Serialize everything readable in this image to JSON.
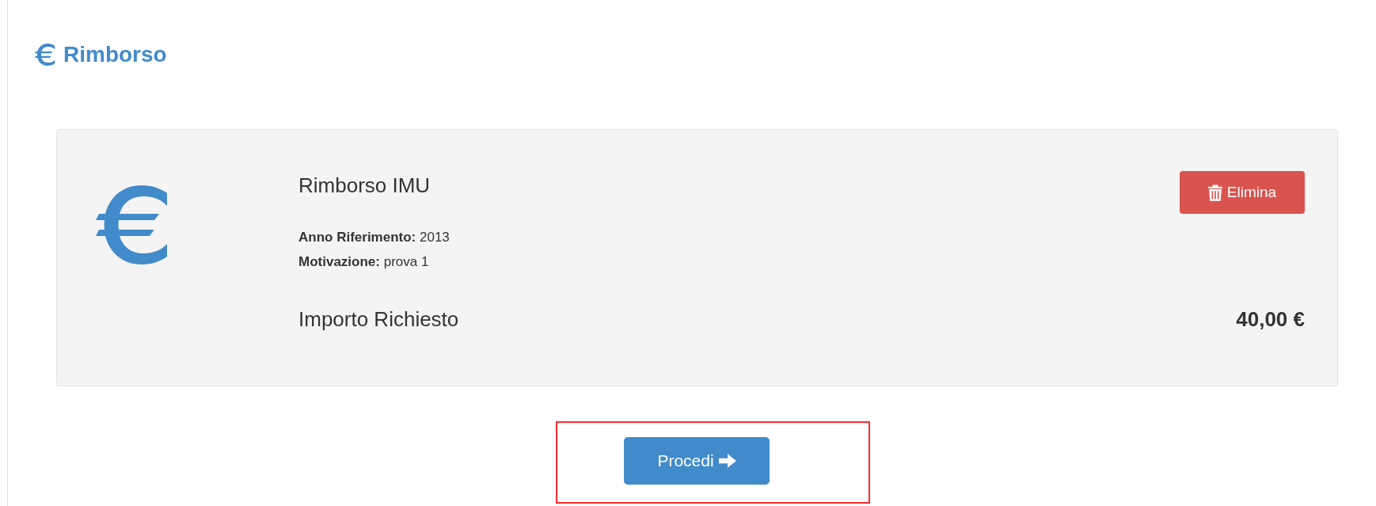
{
  "page_title": "Rimborso",
  "request": {
    "title": "Rimborso IMU",
    "delete_button": "Elimina",
    "fields": [
      {
        "text": "**Anno Riferimento:** 2013"
      },
      {
        "text": "**Motivazione:** prova 1"
      }
    ],
    "amount_label": "Importo Richiesto",
    "amount": "40,00 €"
  },
  "proceed": {
    "label": "Procedi",
    "highlighted": true
  }
}
